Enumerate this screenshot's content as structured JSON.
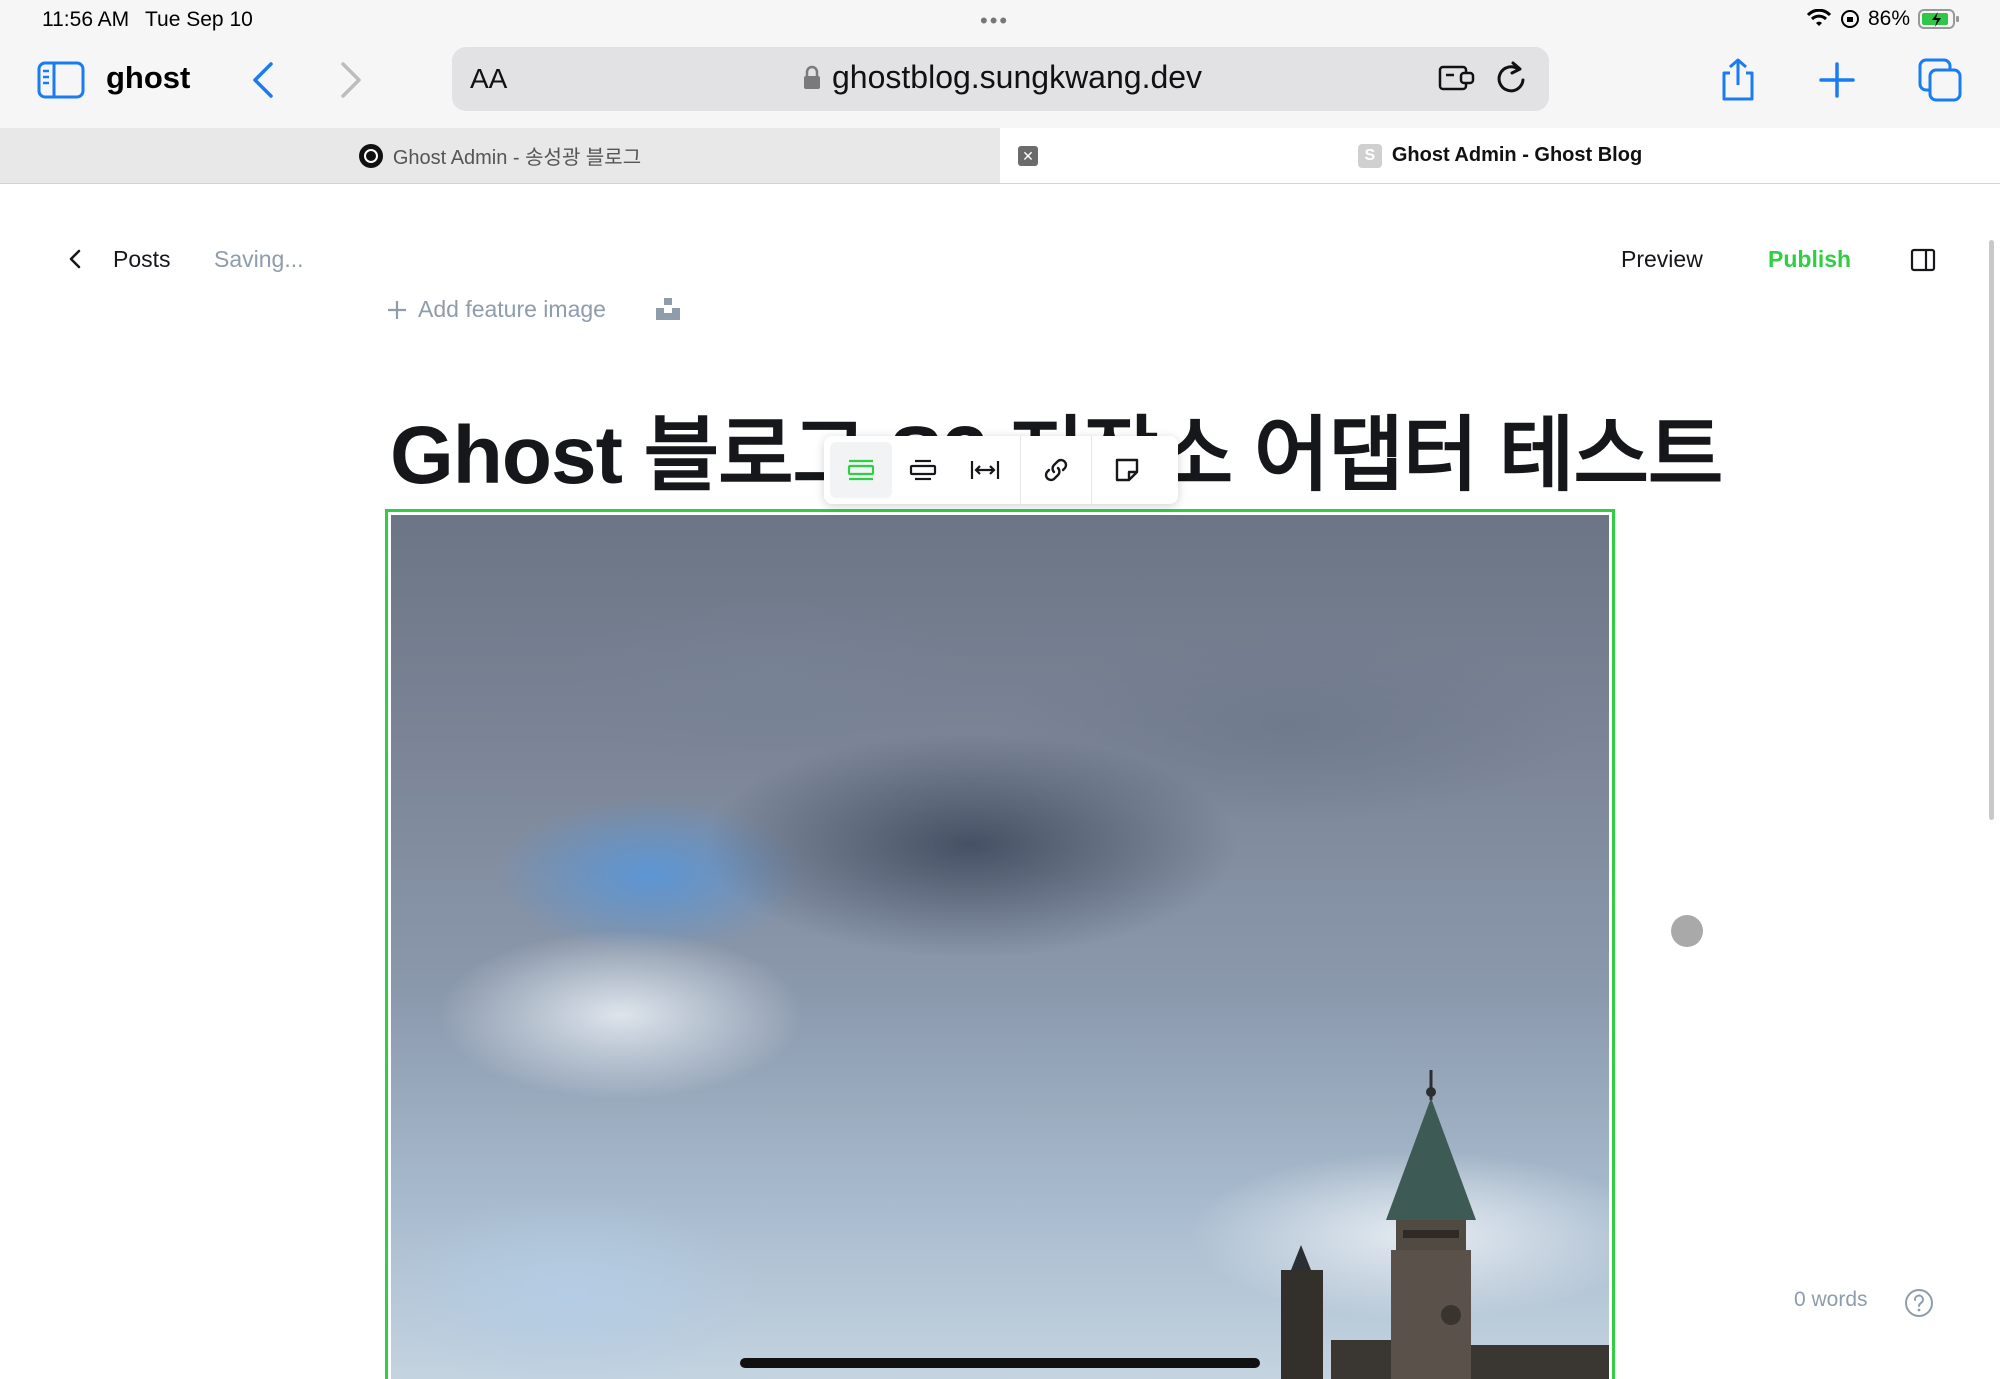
{
  "status": {
    "time": "11:56 AM",
    "date": "Tue Sep 10",
    "battery": "86%"
  },
  "browser": {
    "app_name": "ghost",
    "text_size": "AA",
    "url": "ghostblog.sungkwang.dev",
    "tabs": [
      {
        "label": "Ghost Admin - 송성광 블로그",
        "active": false
      },
      {
        "label": "Ghost Admin - Ghost Blog",
        "active": true,
        "favicon_letter": "S"
      }
    ]
  },
  "editor": {
    "back_label": "Posts",
    "save_status": "Saving...",
    "preview_label": "Preview",
    "publish_label": "Publish",
    "feature_image_label": "Add feature image",
    "title": "Ghost 블로그 S3 저장소 어댑터 테스트",
    "word_count": "0 words",
    "accent_color": "#30cf43"
  },
  "image_toolbar": {
    "buttons": [
      "regular-width",
      "wide-width",
      "full-width",
      "link",
      "snippet"
    ],
    "active": "regular-width"
  }
}
